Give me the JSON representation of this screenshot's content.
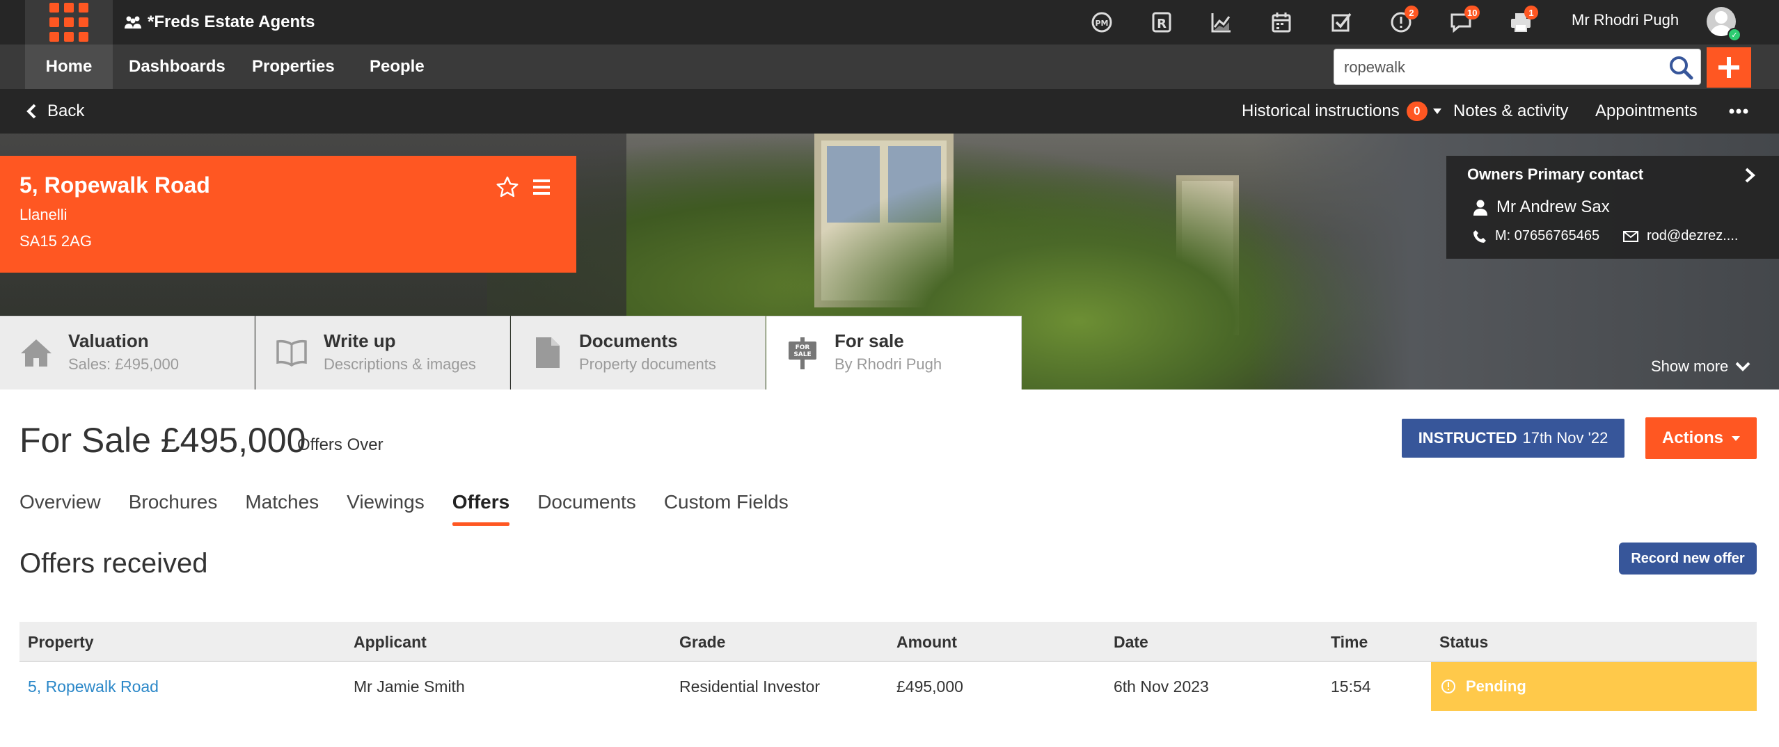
{
  "topbar": {
    "brand": "*Freds Estate Agents",
    "user_name": "Mr Rhodri Pugh",
    "icons": [
      {
        "name": "pm-icon",
        "badge": ""
      },
      {
        "name": "rightmove-icon",
        "badge": ""
      },
      {
        "name": "chart-icon",
        "badge": ""
      },
      {
        "name": "calendar-icon",
        "badge": ""
      },
      {
        "name": "tasks-icon",
        "badge": ""
      },
      {
        "name": "alert-icon",
        "badge": "2"
      },
      {
        "name": "messages-icon",
        "badge": "10"
      },
      {
        "name": "print-icon",
        "badge": "1"
      }
    ]
  },
  "nav": {
    "home": "Home",
    "dashboards": "Dashboards",
    "properties": "Properties",
    "people": "People",
    "search_value": "ropewalk"
  },
  "subnav": {
    "back": "Back",
    "historical": "Historical instructions",
    "historical_count": "0",
    "notes": "Notes & activity",
    "appointments": "Appointments"
  },
  "property": {
    "title": "5, Ropewalk Road",
    "town": "Llanelli",
    "postcode": "SA15 2AG"
  },
  "owner": {
    "heading": "Owners Primary contact",
    "name": "Mr Andrew Sax",
    "phone": "M: 07656765465",
    "email": "rod@dezrez...."
  },
  "show_more": "Show more",
  "stages": [
    {
      "title": "Valuation",
      "sub": "Sales: £495,000",
      "icon": "house-icon"
    },
    {
      "title": "Write up",
      "sub": "Descriptions & images",
      "icon": "book-icon"
    },
    {
      "title": "Documents",
      "sub": "Property documents",
      "icon": "document-icon"
    },
    {
      "title": "For sale",
      "sub": "By Rhodri Pugh",
      "icon": "for-sale-sign-icon"
    }
  ],
  "for_sale_sign": [
    "FOR",
    "SALE"
  ],
  "listing": {
    "price": "For Sale £495,000",
    "qualifier": "Offers Over",
    "status_label": "INSTRUCTED",
    "status_date": "17th Nov '22",
    "actions": "Actions"
  },
  "tabs": [
    "Overview",
    "Brochures",
    "Matches",
    "Viewings",
    "Offers",
    "Documents",
    "Custom Fields"
  ],
  "offers": {
    "title": "Offers received",
    "record_button": "Record new offer",
    "columns": [
      "Property",
      "Applicant",
      "Grade",
      "Amount",
      "Date",
      "Time",
      "Status"
    ],
    "rows": [
      {
        "property": "5, Ropewalk Road",
        "applicant": "Mr Jamie Smith",
        "grade": "Residential Investor",
        "amount": "£495,000",
        "date": "6th Nov 2023",
        "time": "15:54",
        "status": "Pending"
      }
    ]
  },
  "colors": {
    "accent": "#ff5722",
    "primary_blue": "#37569a",
    "link": "#2a87c8",
    "pending": "#ffc94a"
  }
}
